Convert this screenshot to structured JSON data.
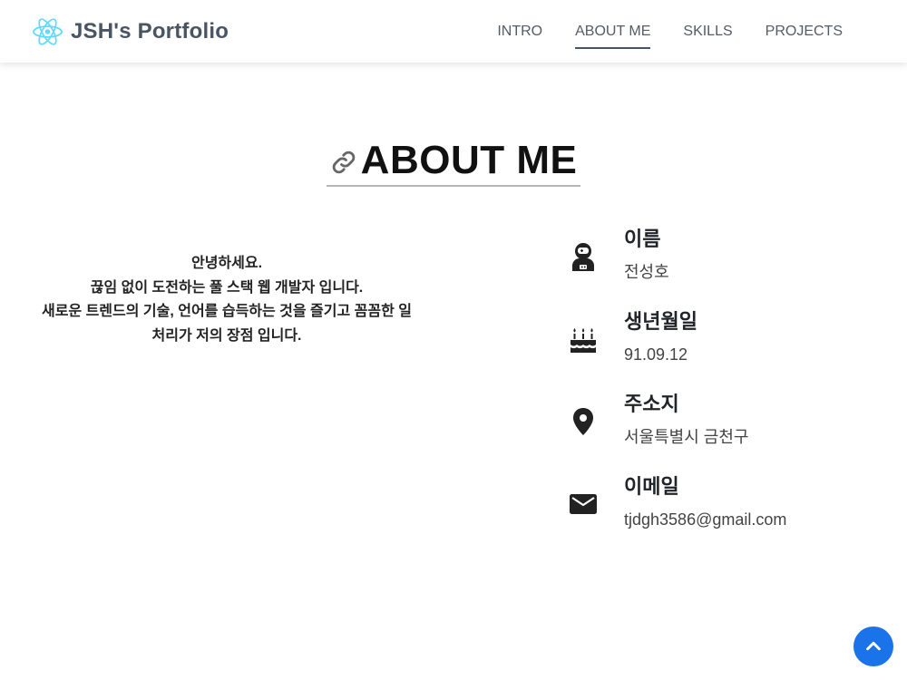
{
  "brand": {
    "title": "JSH's Portfolio",
    "logo_icon": "react-atom-icon",
    "logo_color": "#61dafb"
  },
  "nav": {
    "items": [
      {
        "label": "INTRO"
      },
      {
        "label": "ABOUT ME",
        "active": true
      },
      {
        "label": "SKILLS"
      },
      {
        "label": "PROJECTS"
      }
    ]
  },
  "section": {
    "title": "ABOUT ME",
    "icon": "link-icon"
  },
  "intro": {
    "lines": [
      "안녕하세요.",
      "끊임 없이 도전하는 풀 스택 웹 개발자 입니다.",
      "새로운 트렌드의 기술, 언어를 습득하는 것을 즐기고 꼼꼼한 일",
      "처리가 저의 장점 입니다."
    ]
  },
  "info": [
    {
      "label": "이름",
      "value": "전성호",
      "icon": "astronaut-icon"
    },
    {
      "label": "생년월일",
      "value": "91.09.12",
      "icon": "birthday-cake-icon"
    },
    {
      "label": "주소지",
      "value": "서울특별시 금천구",
      "icon": "map-pin-icon"
    },
    {
      "label": "이메일",
      "value": "tjdgh3586@gmail.com",
      "icon": "mail-icon"
    }
  ],
  "scroll_top": {
    "icon": "chevron-up-icon",
    "color": "#1a73e8"
  }
}
